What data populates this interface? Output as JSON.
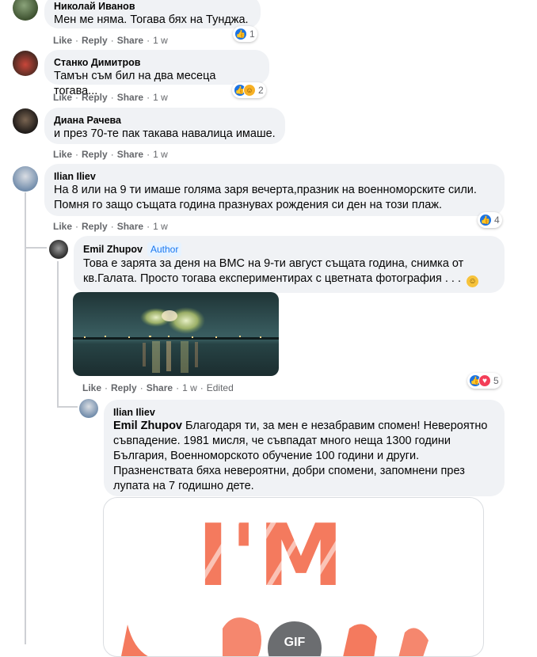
{
  "colors": {
    "bubble": "#f0f2f5",
    "meta": "#65676b",
    "like": "#1b74e4",
    "love": "#f33e58",
    "author_badge": "#1877f2"
  },
  "action_labels": {
    "like": "Like",
    "reply": "Reply",
    "share": "Share"
  },
  "comments": [
    {
      "author": "Николай Иванов",
      "text": "Мен ме няма. Тогава бях на Тунджа.",
      "time": "1 w",
      "reactions": [
        "like-icon"
      ],
      "reaction_count": "1"
    },
    {
      "author": "Станко Димитров",
      "text": "Тамън съм бил на два месеца тогава...",
      "time": "1 w",
      "reactions": [
        "like-icon",
        "haha-icon"
      ],
      "reaction_count": "2"
    },
    {
      "author": "Диана Рачева",
      "text": "и през 70-те пак такава навалица имаше.",
      "time": "1 w"
    },
    {
      "author": "Ilian Iliev",
      "text_lines": [
        "На 8 или на 9 ти имаше голяма заря вечерта,празник на военноморските сили.",
        "Помня го защо същата година празнувах рождения си ден на този плаж."
      ],
      "time": "1 w",
      "reactions": [
        "like-icon"
      ],
      "reaction_count": "4"
    }
  ],
  "reply1": {
    "author": "Emil Zhupov",
    "badge": "Author",
    "text_lines": [
      "Това е зарята за деня на ВМС на 9-ти август същата година, снимка от",
      "кв.Галата. Просто тогава експериментирах с цветната фотография . . ."
    ],
    "emoji": "smiley-emoji",
    "time": "1 w",
    "edited": "Edited",
    "reactions": [
      "like-icon",
      "love-icon"
    ],
    "reaction_count": "5"
  },
  "reply2": {
    "author": "Ilian Iliev",
    "mention": "Emil Zhupov",
    "text_first": " Благодаря ти, за мен е незабравим спомен! Невероятно",
    "text_lines": [
      "съвпадение. 1981 мисля, че съвпадат много неща 1300 години",
      "България, Военноморското обучение 100 години и други.",
      "Празненствата бяха невероятни, добри спомени, запомнени през",
      "лупата на 7 годишно дете."
    ],
    "gif_text": "I'M",
    "gif_badge": "GIF"
  }
}
